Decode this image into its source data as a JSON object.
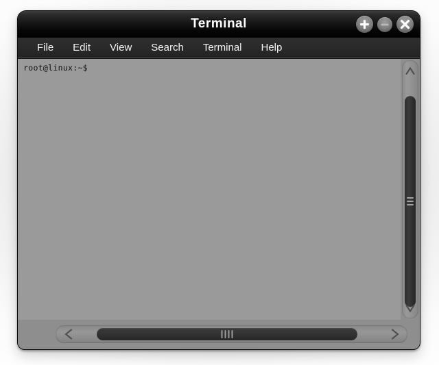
{
  "window": {
    "title": "Terminal",
    "controls": [
      {
        "name": "maximize",
        "icon": "plus-icon",
        "label": "+"
      },
      {
        "name": "minimize",
        "icon": "minus-icon",
        "label": "–"
      },
      {
        "name": "close",
        "icon": "close-icon",
        "label": "✕"
      }
    ]
  },
  "menubar": {
    "items": [
      {
        "label": "File"
      },
      {
        "label": "Edit"
      },
      {
        "label": "View"
      },
      {
        "label": "Search"
      },
      {
        "label": "Terminal"
      },
      {
        "label": "Help"
      }
    ]
  },
  "terminal": {
    "prompt": "root@linux:~$",
    "lines": [
      "root@linux:~$"
    ],
    "background_color": "#9a9a9a",
    "text_color": "#111111"
  },
  "scrollbars": {
    "vertical": {
      "up_arrow_icon": "chevron-up-icon",
      "down_arrow_icon": "chevron-down-icon",
      "grip_lines": 3
    },
    "horizontal": {
      "left_arrow_icon": "chevron-left-icon",
      "right_arrow_icon": "chevron-right-icon",
      "grip_lines": 4
    }
  },
  "colors": {
    "titlebar": "#000000",
    "menubar": "#292929",
    "window_body": "#8e8e8e",
    "terminal_bg": "#9a9a9a",
    "scroll_thumb": "#303030",
    "text": "#ffffff"
  }
}
